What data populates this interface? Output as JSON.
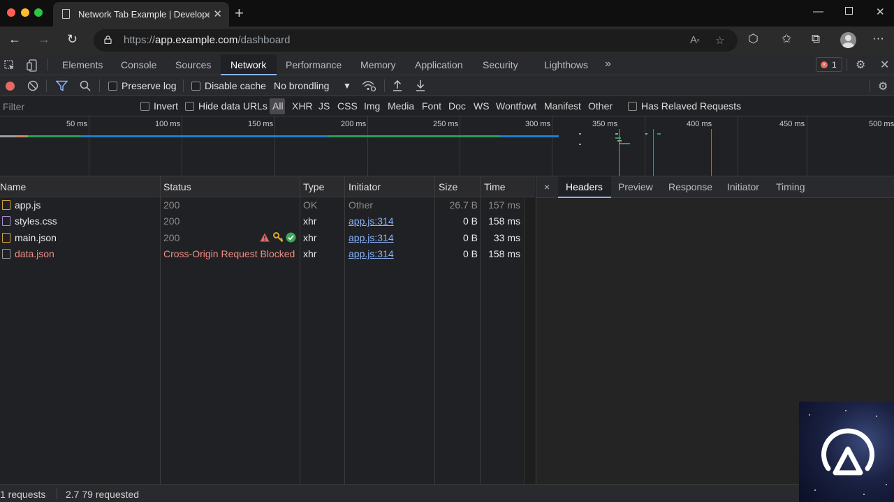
{
  "browser": {
    "tab_title": "Network Tab Example | Developer",
    "url_scheme": "https://",
    "url_host": "app.example.com",
    "url_path": "/dashboard"
  },
  "devtools": {
    "tabs": [
      "Elements",
      "Console",
      "Sources",
      "Network",
      "Performance",
      "Memory",
      "Application",
      "Security",
      "Lighthows"
    ],
    "active_tab": "Network",
    "more_tabs": "»",
    "error_count": "1"
  },
  "toolbar": {
    "preserve_log": "Preserve log",
    "disable_cache": "Disable cache",
    "throttling": "No brondling"
  },
  "filter": {
    "placeholder": "Filter",
    "invert": "Invert",
    "hide_data_urls": "Hide data URLs",
    "types": [
      "All",
      "XHR",
      "JS",
      "CSS",
      "Img",
      "Media",
      "Font",
      "Doc",
      "WS",
      "Wontfowt",
      "Manifest",
      "Other"
    ],
    "has_related": "Has Relaved Requests"
  },
  "overview": {
    "ticks": [
      "50 ms",
      "100 ms",
      "150 ms",
      "200 ms",
      "250 ms",
      "300 ms",
      "350 ms",
      "400 ms",
      "450 ms",
      "500 ms"
    ]
  },
  "table": {
    "columns": [
      "Name",
      "Status",
      "Type",
      "Initiator",
      "Size",
      "Time"
    ],
    "rows": [
      {
        "name": "app.js",
        "status": "200",
        "type": "OK",
        "initiator": "Other",
        "size": "26.7 B",
        "time": "157 ms"
      },
      {
        "name": "styles.css",
        "status": "200",
        "type": "xhr",
        "initiator": "app.js:314",
        "size": "0 B",
        "time": "158 ms"
      },
      {
        "name": "main.json",
        "status": "200",
        "type": "xhr",
        "initiator": "app.js:314",
        "size": "0 B",
        "time": "33 ms"
      },
      {
        "name": "data.json",
        "status": "Cross-Origin Request Blocked",
        "type": "xhr",
        "initiator": "app.js:314",
        "size": "0 B",
        "time": "158 ms"
      }
    ]
  },
  "detail": {
    "tabs": [
      "Headers",
      "Preview",
      "Response",
      "Initiator",
      "Timing"
    ],
    "active_tab": "Headers",
    "close": "×"
  },
  "status": {
    "requests": "1 requests",
    "transferred": "2.7 79 requested"
  },
  "colors": {
    "accent": "#8ab4f8",
    "record": "#e46962",
    "error": "#f28b82"
  }
}
